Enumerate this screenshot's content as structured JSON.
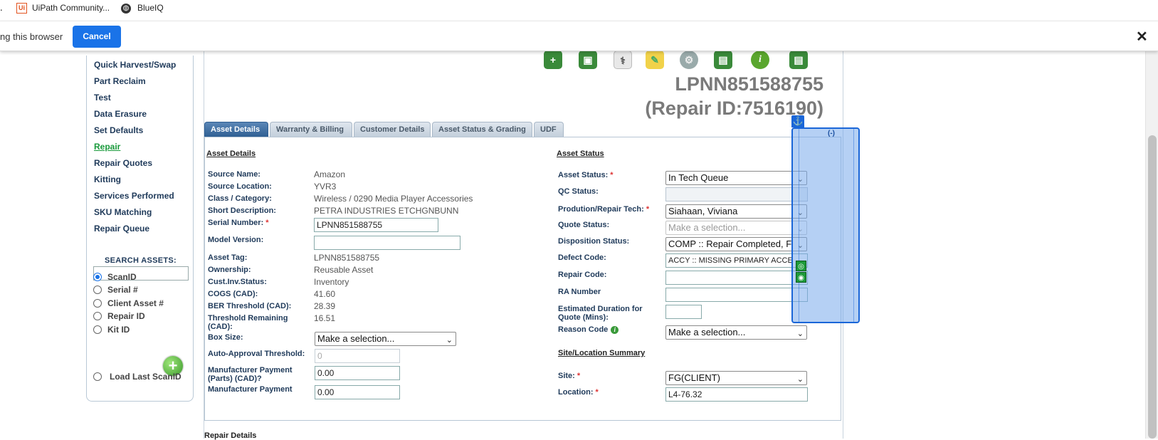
{
  "bookmarks": [
    {
      "label": "UiPath Community...",
      "icon": "uipath-icon"
    },
    {
      "label": "BlueIQ",
      "icon": "globe-icon"
    }
  ],
  "sharebar": {
    "message": "ng this browser",
    "cancel_label": "Cancel",
    "close_glyph": "✕"
  },
  "sidebar": {
    "items": [
      {
        "label": "Quick Harvest/Swap",
        "active": false
      },
      {
        "label": "Part Reclaim",
        "active": false
      },
      {
        "label": "Test",
        "active": false
      },
      {
        "label": "Data Erasure",
        "active": false
      },
      {
        "label": "Set Defaults",
        "active": false
      },
      {
        "label": "Repair",
        "active": true
      },
      {
        "label": "Repair Quotes",
        "active": false
      },
      {
        "label": "Kitting",
        "active": false
      },
      {
        "label": "Services Performed",
        "active": false
      },
      {
        "label": "SKU Matching",
        "active": false
      },
      {
        "label": "Repair Queue",
        "active": false
      }
    ],
    "search_label": "SEARCH ASSETS:",
    "search_value": "",
    "radios": [
      {
        "label": "ScanID",
        "checked": true
      },
      {
        "label": "Serial #",
        "checked": false
      },
      {
        "label": "Client Asset #",
        "checked": false
      },
      {
        "label": "Repair ID",
        "checked": false
      },
      {
        "label": "Kit ID",
        "checked": false
      }
    ],
    "add_glyph": "+",
    "load_last_label": "Load Last ScanID"
  },
  "header": {
    "asset_id": "LPNN851588755",
    "repair_id": "(Repair ID:7516190)"
  },
  "toolbar_icons": [
    "add-record-icon",
    "save-icon",
    "stethoscope-icon",
    "notes-icon",
    "settings-icon",
    "print-icon",
    "info-icon",
    "print-label-icon"
  ],
  "tabs": [
    "Asset Details",
    "Warranty & Billing",
    "Customer Details",
    "Asset Status & Grading",
    "UDF"
  ],
  "asset_details": {
    "title": "Asset Details",
    "source_name_label": "Source Name:",
    "source_name": "Amazon",
    "source_location_label": "Source Location:",
    "source_location": "YVR3",
    "class_label": "Class / Category:",
    "class": "Wireless / 0290 Media Player Accessories",
    "short_desc_label": "Short Description:",
    "short_desc": "PETRA INDUSTRIES ETCHGNBUNN",
    "serial_label": "Serial Number:",
    "serial": "LPNN851588755",
    "model_label": "Model Version:",
    "model": "",
    "asset_tag_label": "Asset Tag:",
    "asset_tag": "LPNN851588755",
    "ownership_label": "Ownership:",
    "ownership": "Reusable Asset",
    "cust_inv_label": "Cust.Inv.Status:",
    "cust_inv": "Inventory",
    "cogs_label": "COGS (CAD):",
    "cogs": "41.60",
    "ber_label": "BER Threshold (CAD):",
    "ber": "28.39",
    "threshold_remaining_label": "Threshold Remaining (CAD):",
    "threshold_remaining": "16.51",
    "box_size_label": "Box Size:",
    "box_size": "Make a selection...",
    "auto_approval_label": "Auto-Approval Threshold:",
    "auto_approval": "0",
    "mfr_parts_label": "Manufacturer Payment (Parts) (CAD)?",
    "mfr_parts": "0.00",
    "mfr_payment_label": "Manufacturer Payment",
    "mfr_payment": "0.00"
  },
  "asset_status": {
    "title": "Asset Status",
    "status_label": "Asset Status:",
    "status": "In Tech Queue",
    "qc_label": "QC Status:",
    "qc": "",
    "tech_label": "Prodution/Repair Tech:",
    "tech": "Siahaan, Viviana",
    "quote_label": "Quote Status:",
    "quote": "Make a selection...",
    "disposition_label": "Disposition Status:",
    "disposition": "COMP :: Repair Completed, F",
    "defect_label": "Defect Code:",
    "defect": "ACCY :: MISSING PRIMARY ACCE",
    "repair_code_label": "Repair Code:",
    "repair_code": "",
    "ra_label": "RA Number",
    "ra": "",
    "duration_label": "Estimated Duration for Quote (Mins):",
    "duration": "",
    "reason_label": "Reason Code",
    "reason": "Make a selection..."
  },
  "site_location": {
    "title": "Site/Location Summary",
    "site_label": "Site:",
    "site": "FG(CLIENT)",
    "location_label": "Location:",
    "location": "L4-76.32"
  },
  "repair_details_title": "Repair Details",
  "overlay": {
    "collapse_label": "(-)",
    "anchor_icon": "anchor-icon"
  },
  "colors": {
    "accent": "#1a73e8",
    "nav_text": "#1f3a5a",
    "nav_active": "#1a9a3c",
    "active_tab": "#2f5f93",
    "asset_id_gray": "#7a7a7a"
  }
}
